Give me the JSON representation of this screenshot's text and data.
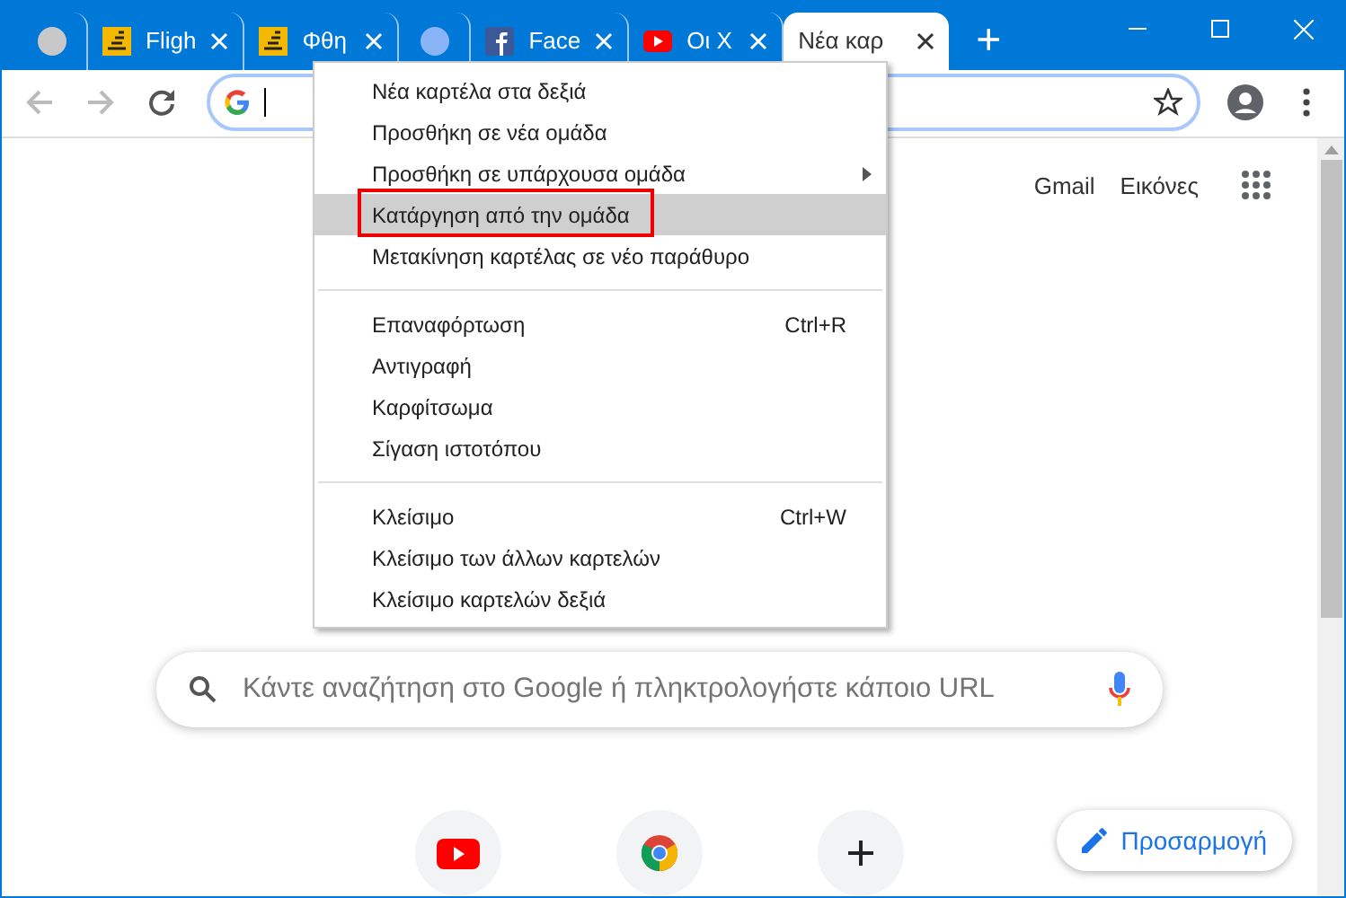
{
  "tabs": [
    {
      "kind": "grey",
      "selected": false
    },
    {
      "kind": "stairs",
      "title": "Fligh",
      "selected": false
    },
    {
      "kind": "stairs",
      "title": "Φθη",
      "selected": false
    },
    {
      "kind": "blue",
      "selected": false
    },
    {
      "kind": "facebook",
      "title": "Face",
      "selected": false
    },
    {
      "kind": "youtube",
      "title": "Οι Χ",
      "selected": false
    },
    {
      "kind": "blank",
      "title": "Νέα καρ",
      "selected": true
    }
  ],
  "new_tab": "+",
  "page": {
    "links": [
      "Gmail",
      "Εικόνες"
    ],
    "search_placeholder": "Κάντε αναζήτηση στο Google ή πληκτρολογήστε κάποιο URL",
    "shortcuts": [
      {
        "kind": "youtube"
      },
      {
        "kind": "chrome"
      },
      {
        "kind": "add"
      }
    ],
    "customize": "Προσαρμογή"
  },
  "context_menu": {
    "groups": [
      [
        {
          "label": "Νέα καρτέλα στα δεξιά",
          "selected": false
        },
        {
          "label": "Προσθήκη σε νέα ομάδα",
          "selected": false
        },
        {
          "label": "Προσθήκη σε υπάρχουσα ομάδα",
          "submenu": true,
          "selected": false
        },
        {
          "label": "Κατάργηση από την ομάδα",
          "selected": true
        },
        {
          "label": "Μετακίνηση καρτέλας σε νέο παράθυρο",
          "selected": false
        }
      ],
      [
        {
          "label": "Επαναφόρτωση",
          "shortcut": "Ctrl+R",
          "selected": false
        },
        {
          "label": "Αντιγραφή",
          "selected": false
        },
        {
          "label": "Καρφίτσωμα",
          "selected": false
        },
        {
          "label": "Σίγαση ιστοτόπου",
          "selected": false
        }
      ],
      [
        {
          "label": "Κλείσιμο",
          "shortcut": "Ctrl+W",
          "selected": false
        },
        {
          "label": "Κλείσιμο των άλλων καρτελών",
          "selected": false
        },
        {
          "label": "Κλείσιμο καρτελών δεξιά",
          "selected": false
        }
      ]
    ]
  }
}
